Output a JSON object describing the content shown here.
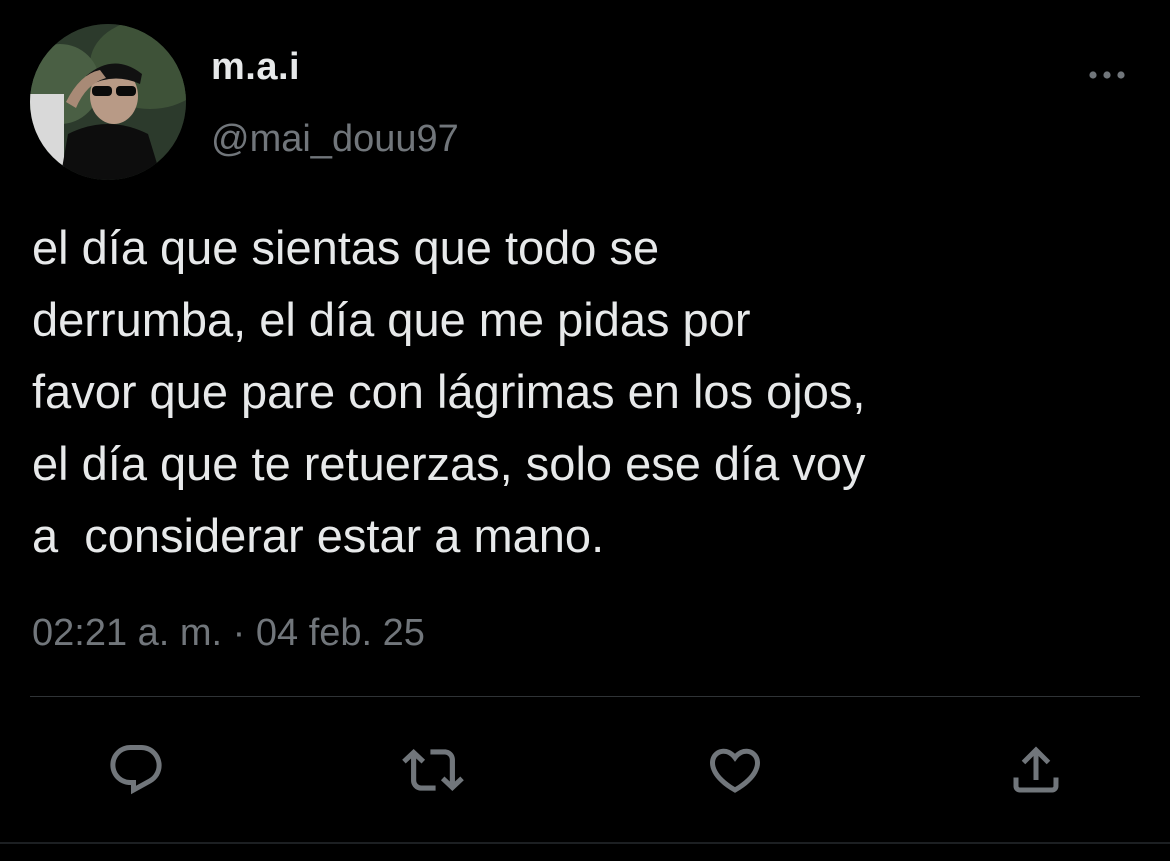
{
  "user": {
    "display_name": "m.a.i",
    "handle": "@mai_douu97"
  },
  "tweet": {
    "text": "el día que sientas que todo se\nderrumba, el día que me pidas por\nfavor que pare con lágrimas en los ojos,\nel día que te retuerzas, solo ese día voy\na  considerar estar a mano.",
    "timestamp": "02:21 a. m. · 04 feb. 25"
  },
  "icons": {
    "more": "more-horizontal-icon",
    "reply": "reply-icon",
    "retweet": "retweet-icon",
    "like": "heart-icon",
    "share": "share-icon"
  },
  "colors": {
    "background": "#000000",
    "text_primary": "#e7e9ea",
    "text_secondary": "#71767b",
    "divider": "#2f3336"
  }
}
